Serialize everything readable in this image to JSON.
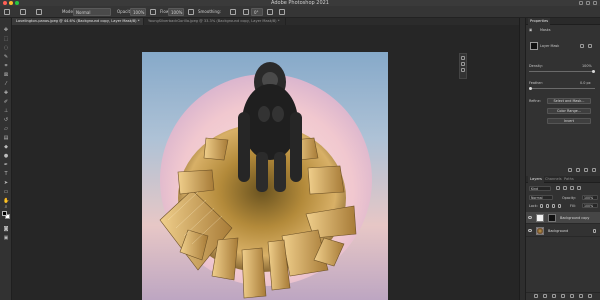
{
  "window": {
    "title": "Adobe Photoshop 2021"
  },
  "options_bar": {
    "mode_label": "Mode:",
    "mode_value": "Normal",
    "opacity_label": "Opacity:",
    "opacity_value": "100%",
    "flow_label": "Flow:",
    "flow_value": "100%",
    "smoothing_label": "Smoothing:",
    "angle_value": "0°"
  },
  "tabs": [
    {
      "label": "Lovelington-panos.jpeg @ 44.6% (Background copy, Layer Mask/8) *",
      "active": true
    },
    {
      "label": "YoungSilverbackGorilla.jpeg @ 33.3% (Background copy, Layer Mask/8) *",
      "active": false
    }
  ],
  "properties": {
    "tabs": [
      "Properties"
    ],
    "section_title": "Masks",
    "layer_mask_label": "Layer Mask",
    "density_label": "Density:",
    "density_value": "100%",
    "feather_label": "Feather:",
    "feather_value": "0.0 px",
    "refine_label": "Refine:",
    "select_and_mask_button": "Select and Mask...",
    "color_range_button": "Color Range...",
    "invert_button": "Invert"
  },
  "layers_panel": {
    "tabs": [
      "Layers",
      "Channels",
      "Paths"
    ],
    "kind_filter": "Kind",
    "blend_mode": "Normal",
    "opacity_label": "Opacity:",
    "opacity_value": "100%",
    "lock_label": "Lock:",
    "fill_label": "Fill:",
    "fill_value": "100%",
    "layers": [
      {
        "name": "Background copy",
        "selected": true,
        "has_mask": true
      },
      {
        "name": "Background",
        "selected": false,
        "has_mask": false
      }
    ]
  },
  "colors": {
    "app_bg": "#262626",
    "panel_bg": "#323232",
    "selected_layer": "#464646"
  }
}
